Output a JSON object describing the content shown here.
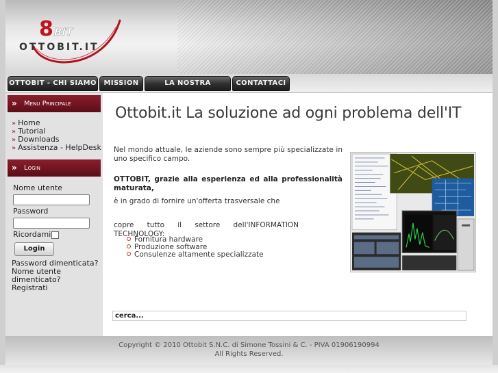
{
  "header": {
    "logo_mark": "8BIT",
    "logo_text": "OTTOBIT.IT"
  },
  "nav": {
    "items": [
      "OTTOBIT - CHI SIAMO",
      "MISSION",
      "LA NOSTRA OFFERTA",
      "CONTATTACI"
    ]
  },
  "sidebar": {
    "menu_title": "Menu Principale",
    "menu_items": [
      "Home",
      "Tutorial",
      "Downloads",
      "Assistenza - HelpDesk"
    ],
    "login_title": "Login",
    "username_label": "Nome utente",
    "password_label": "Password",
    "remember_label": "Ricordami",
    "login_button": "Login",
    "forgot_password": "Password dimenticata?",
    "forgot_username_1": "Nome utente",
    "forgot_username_2": "dimenticato?",
    "register": "Registrati"
  },
  "main": {
    "title": "Ottobit.it La soluzione ad ogni problema dell'IT",
    "para1": "Nel mondo attuale, le aziende sono sempre più specializzate in uno specifico campo.",
    "para2": "OTTOBIT, grazie alla esperienza ed alla professionalità maturata,",
    "para3": "è in grado di fornire un'offerta trasversale che",
    "para4": "copre tutto il settore dell'INFORMATION TECHNOLOGY:",
    "bullets": [
      "Fornitura hardware",
      "Produzione software",
      "Consulenze altamente specializzate"
    ],
    "search_value": "cerca..."
  },
  "footer": {
    "line1": "Copyright © 2010 Ottobit S.N.C. di Simone Tossini & C. - PIVA 01906190994",
    "line2": "All Rights Reserved."
  },
  "colors": {
    "accent": "#8a1e2c",
    "nav_bg": "#2e2e2e",
    "bullet": "#c0392b"
  }
}
